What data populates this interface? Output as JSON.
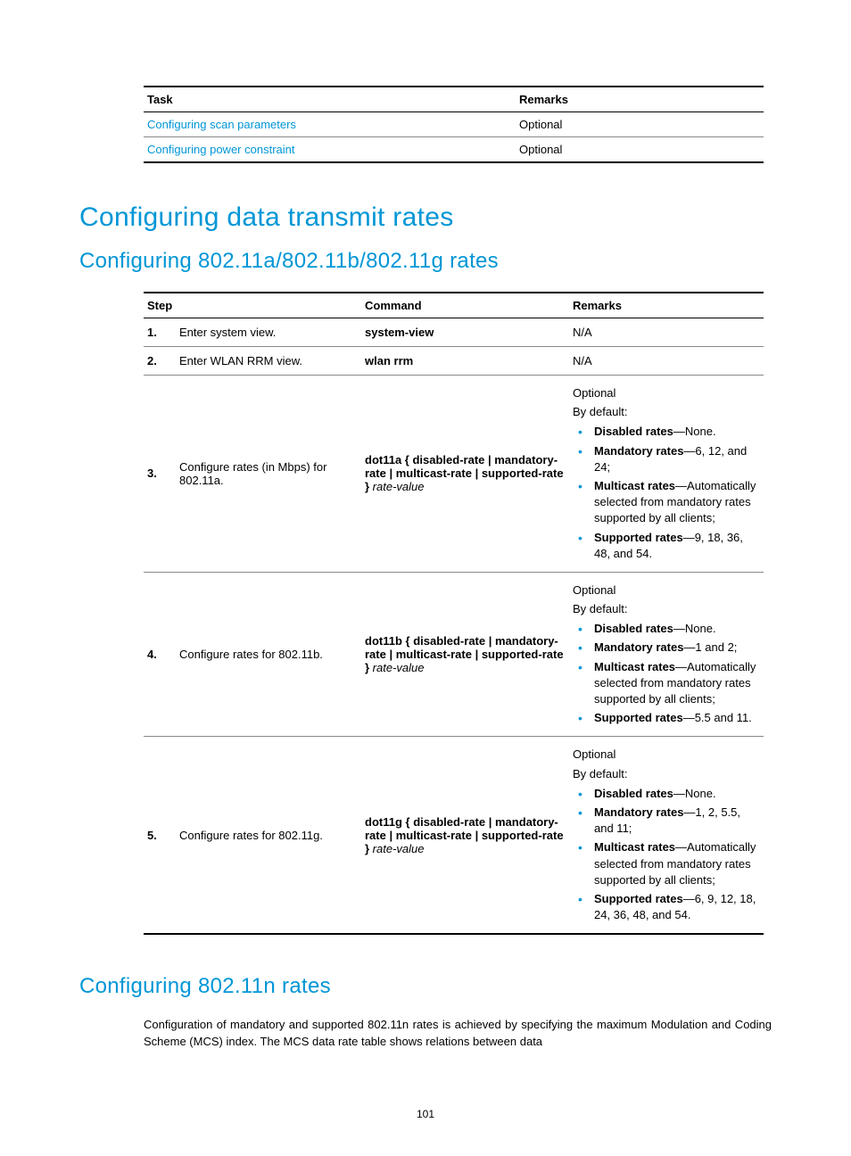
{
  "task_table": {
    "headers": [
      "Task",
      "Remarks"
    ],
    "rows": [
      {
        "task": "Configuring scan parameters",
        "remark": "Optional"
      },
      {
        "task": "Configuring power constraint",
        "remark": "Optional"
      }
    ]
  },
  "h1": "Configuring data transmit rates",
  "h2a": "Configuring 802.11a/802.11b/802.11g rates",
  "steps_table": {
    "headers": [
      "Step",
      "Command",
      "Remarks"
    ],
    "rows": [
      {
        "num": "1.",
        "step": "Enter system view.",
        "cmd_bold": "system-view",
        "cmd_rest": "",
        "remarks_plain": "N/A"
      },
      {
        "num": "2.",
        "step": "Enter WLAN RRM view.",
        "cmd_bold": "wlan rrm",
        "cmd_rest": "",
        "remarks_plain": "N/A"
      },
      {
        "num": "3.",
        "step": "Configure rates (in Mbps) for 802.11a.",
        "cmd_prefix": "dot11a",
        "cmd_options": " { disabled-rate | mandatory-rate | multicast-rate | supported-rate } ",
        "cmd_ital": "rate-value",
        "remarks_intro1": "Optional",
        "remarks_intro2": "By default:",
        "bullets": [
          {
            "b": "Disabled rates",
            "t": "—None."
          },
          {
            "b": "Mandatory rates",
            "t": "—6, 12, and 24;"
          },
          {
            "b": "Multicast rates",
            "t": "—Automatically selected from mandatory rates supported by all clients;"
          },
          {
            "b": "Supported rates",
            "t": "—9, 18, 36, 48, and 54."
          }
        ]
      },
      {
        "num": "4.",
        "step": "Configure rates for 802.11b.",
        "cmd_prefix": "dot11b",
        "cmd_options": " { disabled-rate | mandatory-rate | multicast-rate | supported-rate } ",
        "cmd_ital": "rate-value",
        "remarks_intro1": "Optional",
        "remarks_intro2": "By default:",
        "bullets": [
          {
            "b": "Disabled rates",
            "t": "—None."
          },
          {
            "b": "Mandatory rates",
            "t": "—1 and 2;"
          },
          {
            "b": "Multicast rates",
            "t": "—Automatically selected from mandatory rates supported by all clients;"
          },
          {
            "b": "Supported rates",
            "t": "—5.5 and 11."
          }
        ]
      },
      {
        "num": "5.",
        "step": "Configure rates for 802.11g.",
        "cmd_prefix": "dot11g",
        "cmd_options": " { disabled-rate | mandatory-rate | multicast-rate | supported-rate } ",
        "cmd_ital": "rate-value",
        "remarks_intro1": "Optional",
        "remarks_intro2": "By default:",
        "bullets": [
          {
            "b": "Disabled rates",
            "t": "—None."
          },
          {
            "b": "Mandatory rates",
            "t": "—1, 2, 5.5, and 11;"
          },
          {
            "b": "Multicast rates",
            "t": "—Automatically selected from mandatory rates supported by all clients;"
          },
          {
            "b": "Supported rates",
            "t": "—6, 9, 12, 18, 24, 36, 48, and 54."
          }
        ]
      }
    ]
  },
  "h2b": "Configuring 802.11n rates",
  "para": "Configuration of mandatory and supported 802.11n rates is achieved by specifying the maximum Modulation and Coding Scheme (MCS) index. The MCS data rate table shows relations between data",
  "page_number": "101"
}
